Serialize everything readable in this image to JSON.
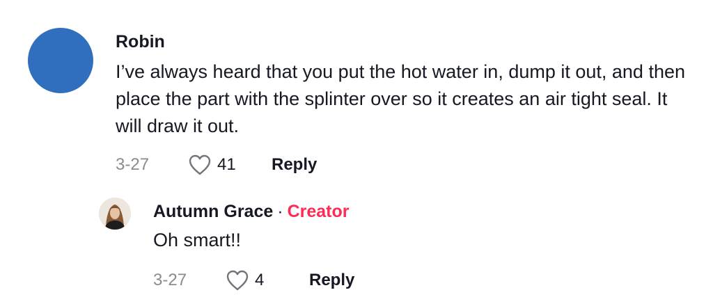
{
  "comment": {
    "avatar_color": "#2f6fbd",
    "username": "Robin",
    "text": "I’ve always heard that you put the hot water in, dump it out, and then place the part with the splinter over so it creates an air tight seal. It will draw it out.",
    "date": "3-27",
    "like_count": "41",
    "like_icon": "heart-outline-icon",
    "reply_label": "Reply"
  },
  "reply": {
    "username": "Autumn Grace",
    "separator": "·",
    "badge": "Creator",
    "badge_color": "#fe2c55",
    "text": "Oh smart!!",
    "date": "3-27",
    "like_count": "4",
    "like_icon": "heart-outline-icon",
    "reply_label": "Reply"
  }
}
